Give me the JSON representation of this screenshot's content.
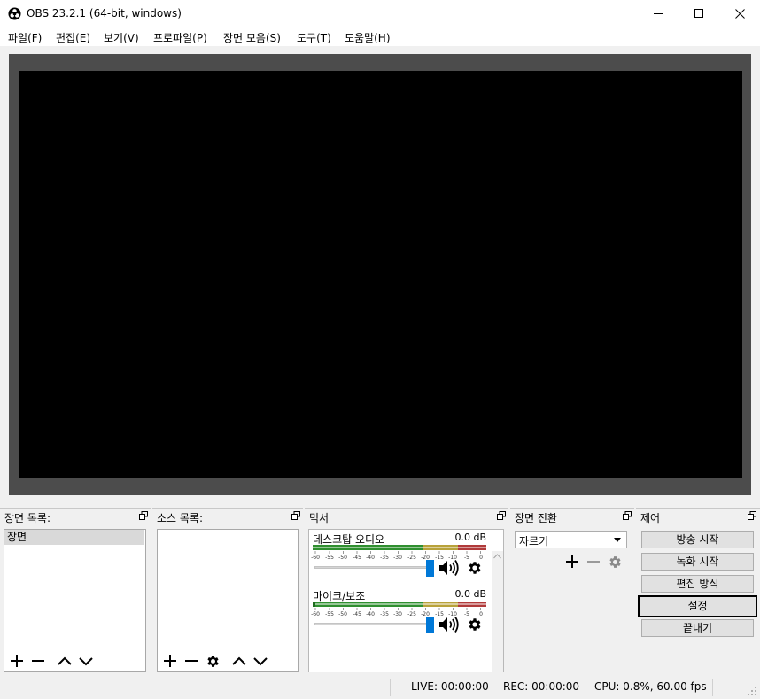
{
  "window": {
    "title": "OBS 23.2.1 (64-bit, windows)"
  },
  "menu": [
    {
      "label": "파일(F)"
    },
    {
      "label": "편집(E)"
    },
    {
      "label": "보기(V)"
    },
    {
      "label": "프로파일(P)"
    },
    {
      "label": "장면 모음(S)"
    },
    {
      "label": "도구(T)"
    },
    {
      "label": "도움말(H)"
    }
  ],
  "docks": {
    "scenes": {
      "title": "장면 목록:",
      "items": [
        "장면"
      ]
    },
    "sources": {
      "title": "소스 목록:"
    },
    "mixer": {
      "title": "믹서",
      "scale": [
        "-60",
        "-55",
        "-50",
        "-45",
        "-40",
        "-35",
        "-30",
        "-25",
        "-20",
        "-15",
        "-10",
        "-5",
        "0"
      ],
      "channels": [
        {
          "name": "데스크탑 오디오",
          "level": "0.0 dB"
        },
        {
          "name": "마이크/보조",
          "level": "0.0 dB"
        }
      ]
    },
    "transitions": {
      "title": "장면 전환",
      "selected": "자르기"
    },
    "controls": {
      "title": "제어",
      "buttons": [
        "방송 시작",
        "녹화 시작",
        "편집 방식",
        "설정",
        "끝내기"
      ]
    }
  },
  "status": {
    "live": "LIVE: 00:00:00",
    "rec": "REC: 00:00:00",
    "cpu": "CPU: 0.8%, 60.00 fps"
  },
  "colors": {
    "accent": "#0078d7",
    "preview_bg": "#4c4c4c",
    "meter_green": "#2f8f2f",
    "meter_yellow": "#b8a23a",
    "meter_red": "#b03a3a"
  }
}
